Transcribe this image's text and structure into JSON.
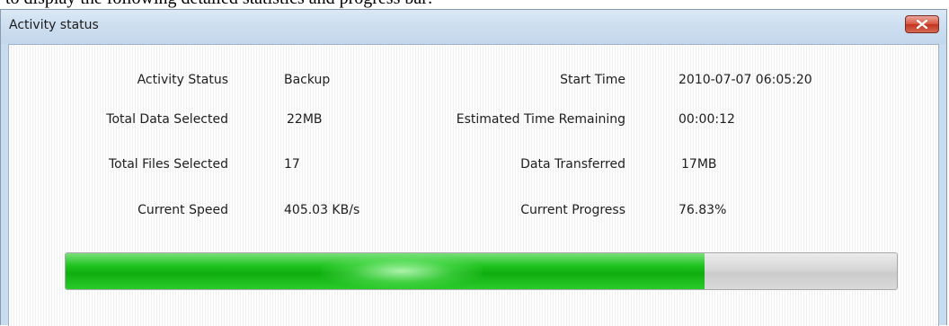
{
  "page_header": {
    "partial_text": "to display the following detailed statistics and progress bar:"
  },
  "window": {
    "title": "Activity status"
  },
  "stats": {
    "activity_status": {
      "label": "Activity Status",
      "value": "Backup"
    },
    "start_time": {
      "label": "Start Time",
      "value": "2010-07-07 06:05:20"
    },
    "total_data_selected": {
      "label": "Total Data Selected",
      "value": "22MB"
    },
    "estimated_time_remaining": {
      "label": "Estimated Time Remaining",
      "value": "00:00:12"
    },
    "total_files_selected": {
      "label": "Total Files Selected",
      "value": "17"
    },
    "data_transferred": {
      "label": "Data Transferred",
      "value": "17MB"
    },
    "current_speed": {
      "label": "Current Speed",
      "value": "405.03 KB/s"
    },
    "current_progress": {
      "label": "Current Progress",
      "value": "76.83%"
    }
  },
  "progress": {
    "fraction": 0.7683
  },
  "colors": {
    "progress_green": "#1fc31f",
    "close_red": "#c2341f",
    "titlebar": "#cddff0"
  },
  "icons": {
    "close": "close-icon"
  }
}
